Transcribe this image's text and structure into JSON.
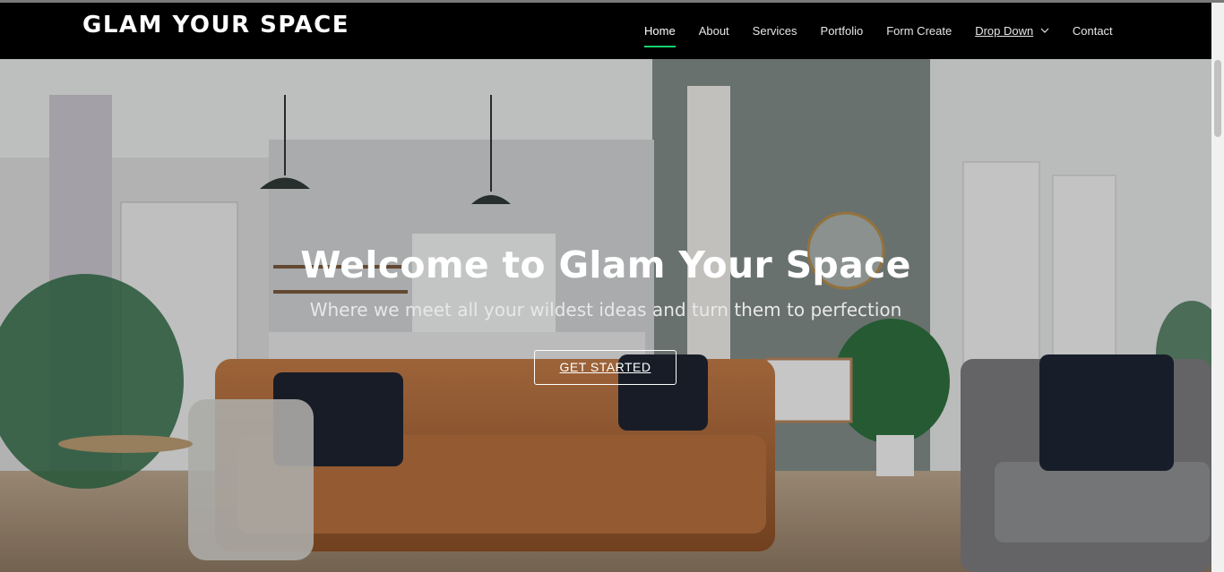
{
  "brand": {
    "logo": "GLAM YOUR SPACE",
    "accent": "#18d26e"
  },
  "nav": {
    "items": [
      {
        "label": "Home",
        "active": true
      },
      {
        "label": "About"
      },
      {
        "label": "Services"
      },
      {
        "label": "Portfolio"
      },
      {
        "label": "Form Create"
      },
      {
        "label": "Drop Down",
        "icon": "chevron-down-icon"
      },
      {
        "label": "Contact"
      }
    ]
  },
  "hero": {
    "title": "Welcome to Glam Your Space",
    "subtitle": "Where we meet all your wildest ideas and turn them to perfection",
    "cta": "GET STARTED"
  }
}
